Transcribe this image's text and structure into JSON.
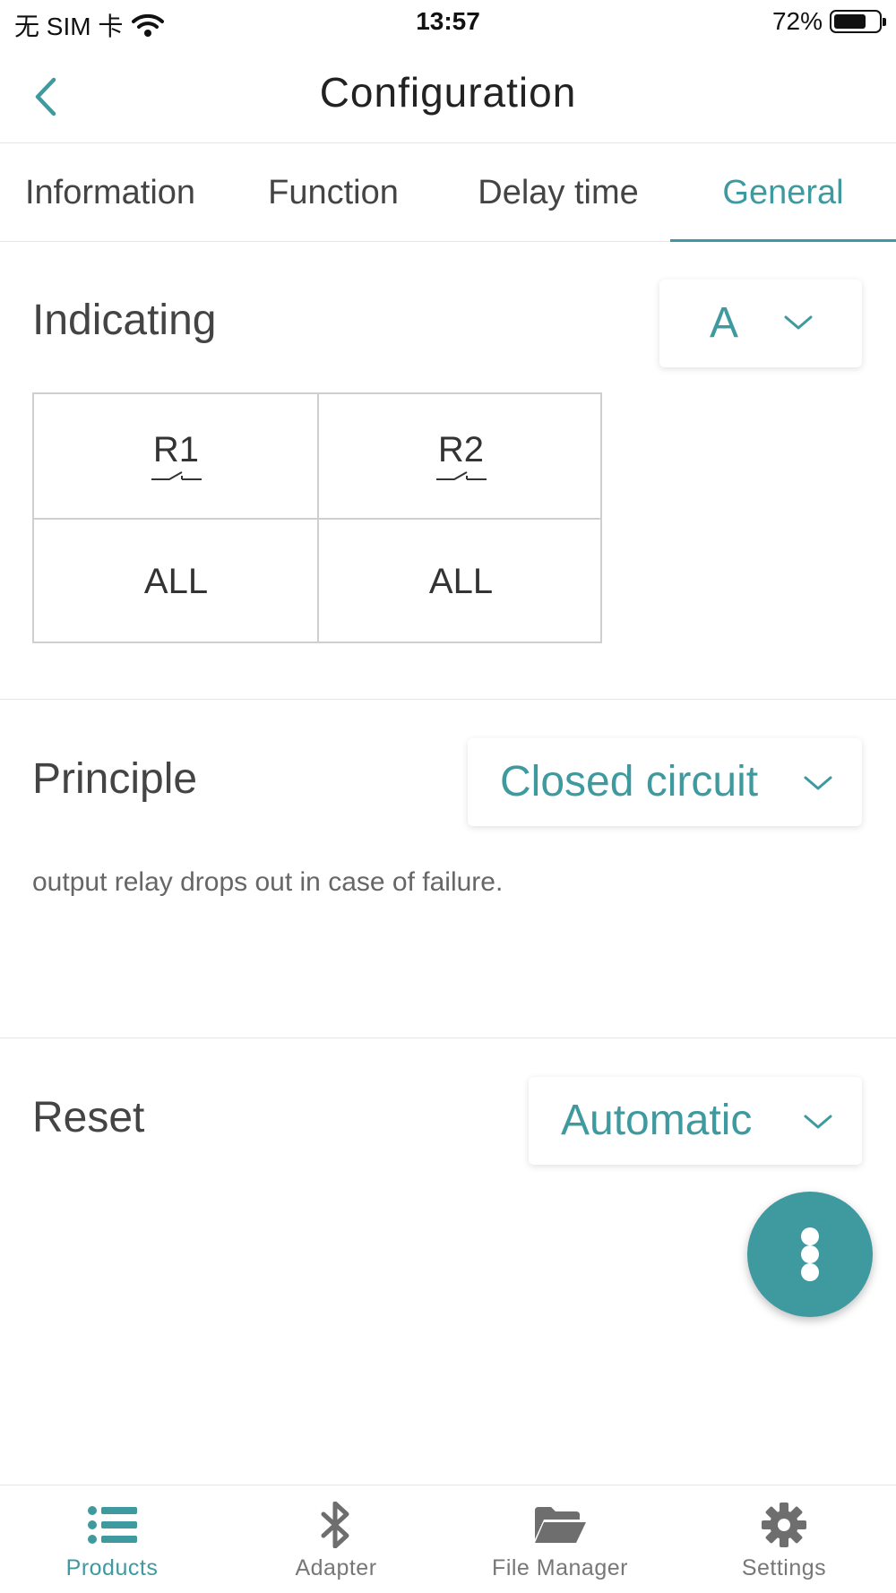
{
  "status_bar": {
    "carrier": "无 SIM 卡",
    "time": "13:57",
    "battery_percent": "72%",
    "battery_level": 0.72
  },
  "nav": {
    "title": "Configuration",
    "back_icon": "chevron-left-icon"
  },
  "tabs": [
    {
      "label": "Information",
      "active": false
    },
    {
      "label": "Function",
      "active": false
    },
    {
      "label": "Delay time",
      "active": false
    },
    {
      "label": "General",
      "active": true
    }
  ],
  "indicating": {
    "label": "Indicating",
    "selected": "A",
    "relays": [
      {
        "name": "R1",
        "value": "ALL"
      },
      {
        "name": "R2",
        "value": "ALL"
      }
    ]
  },
  "principle": {
    "label": "Principle",
    "selected": "Closed circuit",
    "description": "output relay drops out in case of failure."
  },
  "reset": {
    "label": "Reset",
    "selected": "Automatic"
  },
  "bottom_tabs": [
    {
      "label": "Products",
      "icon": "list-icon",
      "active": true
    },
    {
      "label": "Adapter",
      "icon": "bluetooth-icon",
      "active": false
    },
    {
      "label": "File Manager",
      "icon": "folder-open-icon",
      "active": false
    },
    {
      "label": "Settings",
      "icon": "gear-icon",
      "active": false
    }
  ],
  "colors": {
    "accent": "#3f9aa0",
    "text": "#444444",
    "border": "#cfcfcf"
  }
}
